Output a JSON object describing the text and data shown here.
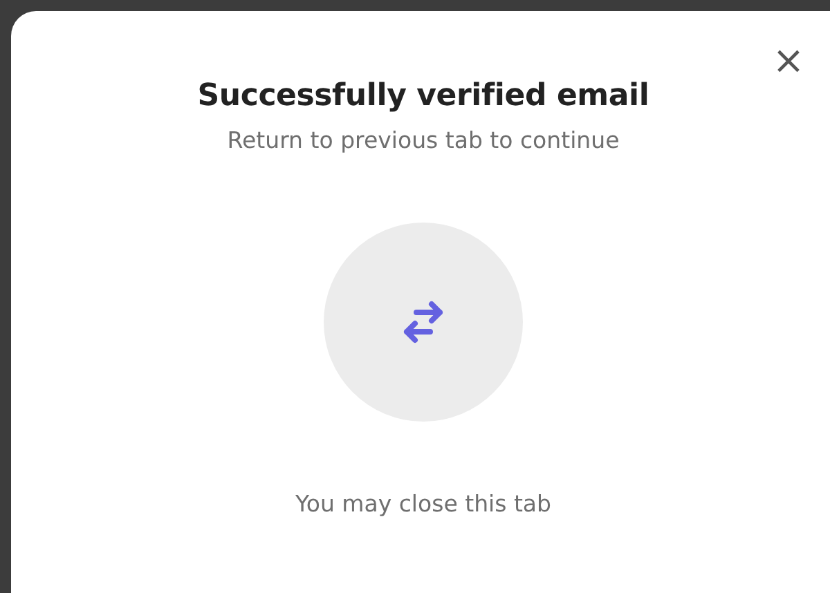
{
  "dialog": {
    "close_label": "×",
    "title": "Successfully verified email",
    "subtitle": "Return to previous tab to continue",
    "footer": "You may close this tab"
  }
}
